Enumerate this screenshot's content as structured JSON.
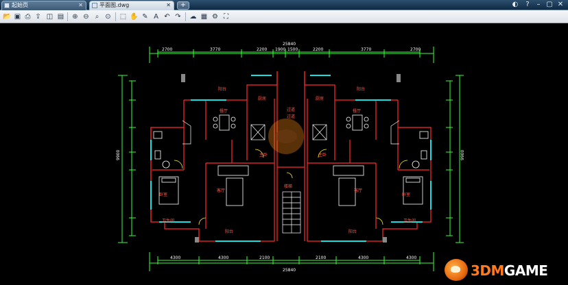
{
  "window": {
    "tabs": [
      {
        "label": "起始页"
      },
      {
        "label": "平面图.dwg"
      }
    ],
    "new_tab_label": "+"
  },
  "toolbar": {
    "icons": [
      "open-icon",
      "save-icon",
      "print-icon",
      "export-icon",
      "layers-icon",
      "measure-icon",
      "zoom-in-icon",
      "zoom-out-icon",
      "zoom-window-icon",
      "zoom-extent-icon",
      "select-icon",
      "pan-icon",
      "pencil-icon",
      "text-icon",
      "undo-icon",
      "redo-icon",
      "cloud-icon",
      "layout-icon",
      "settings-icon",
      "fullscreen-icon"
    ]
  },
  "drawing": {
    "dimensions_top": [
      "2700",
      "3770",
      "2200",
      "1900",
      "1500",
      "2200",
      "3770",
      "2700"
    ],
    "overall_top": "25840",
    "overall_bottom": "25840",
    "dimensions_bottom": [
      "4300",
      "4300",
      "2100",
      "2100",
      "4300",
      "4300"
    ],
    "side_dim_left": "9900",
    "side_dim_right": "9900",
    "room_labels": [
      "阳台",
      "阳台",
      "厨房",
      "厨房",
      "卧室",
      "卧室",
      "客厅",
      "客厅",
      "主卧",
      "主卧",
      "阳台",
      "阳台",
      "卫生间",
      "卫生间",
      "餐厅",
      "餐厅",
      "过道",
      "过道",
      "楼梯"
    ]
  },
  "watermark": {
    "prefix": "3DM",
    "suffix": "GAME"
  },
  "colors": {
    "wall": "#ff2a2a",
    "dimension": "#39ff39",
    "window": "#19e0e0",
    "furniture": "#ffffff",
    "door": "#ffee22",
    "accent": "#ff7a1a"
  }
}
